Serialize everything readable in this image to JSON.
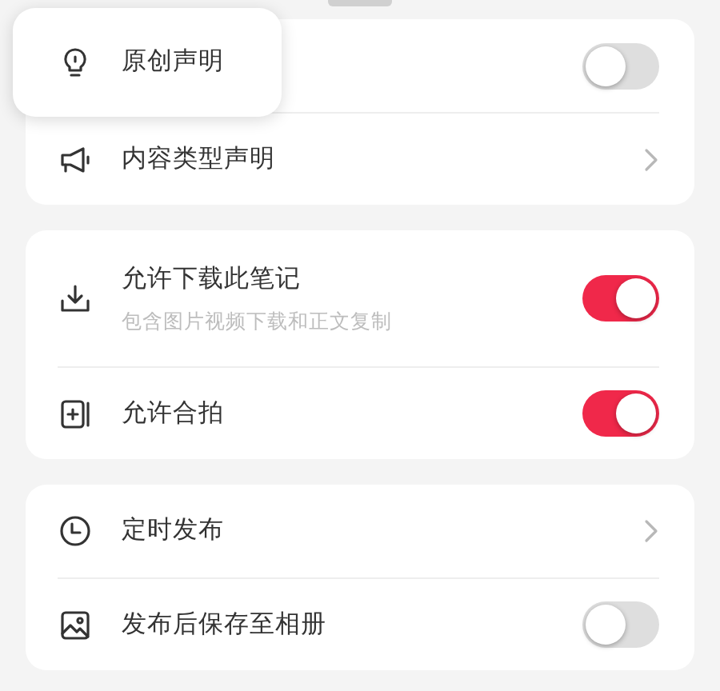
{
  "highlight_popup": {
    "label": "原创声明"
  },
  "cards": [
    {
      "rows": [
        {
          "kind": "toggle",
          "on": false
        },
        {
          "kind": "link",
          "label": "内容类型声明"
        }
      ]
    },
    {
      "rows": [
        {
          "kind": "toggle",
          "label": "允许下载此笔记",
          "subtitle": "包含图片视频下载和正文复制",
          "on": true
        },
        {
          "kind": "toggle",
          "label": "允许合拍",
          "on": true
        }
      ]
    },
    {
      "rows": [
        {
          "kind": "link",
          "label": "定时发布"
        },
        {
          "kind": "toggle",
          "label": "发布后保存至相册",
          "on": false
        }
      ]
    }
  ]
}
